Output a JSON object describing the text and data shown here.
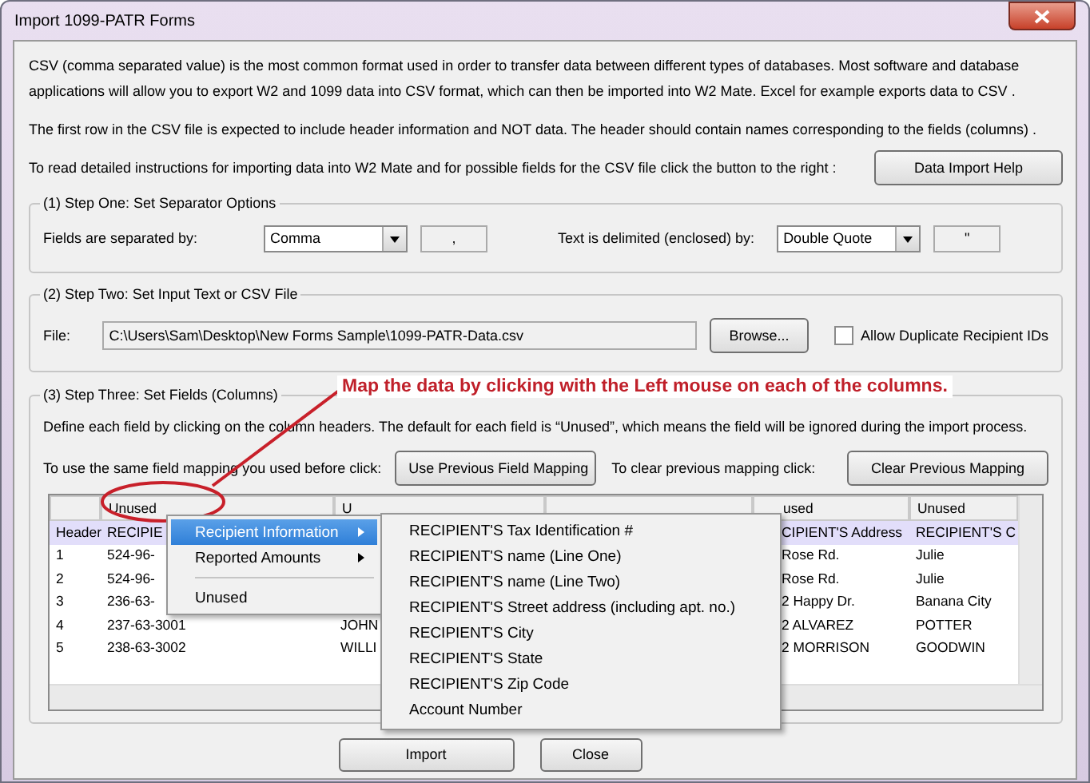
{
  "window": {
    "title": "Import 1099-PATR Forms"
  },
  "intro": {
    "paragraphs": [
      "CSV (comma separated value) is the most common format used in order to transfer data between different types of databases.  Most software and database applications will allow you to export W2 and 1099 data into CSV format, which can then be imported into W2 Mate. Excel for example exports data to CSV .",
      "The first row in the CSV file is expected to include header information and NOT data. The header should contain names corresponding to the fields (columns) ."
    ],
    "help_prompt": "To read detailed instructions for importing data into W2 Mate and for possible fields for the CSV file click the button to the right :",
    "help_button": "Data Import Help"
  },
  "step_one": {
    "title": "(1)  Step One: Set Separator Options",
    "field_separator_label": "Fields are separated by:",
    "field_separator": "Comma",
    "field_separator_char": ",",
    "text_delimiter_label": "Text is delimited (enclosed) by:",
    "text_delimiter": "Double Quote",
    "text_delimiter_char": "\""
  },
  "step_two": {
    "title": "(2)  Step Two: Set Input Text or CSV File",
    "file_label": "File:",
    "file_path": "C:\\Users\\Sam\\Desktop\\New Forms Sample\\1099-PATR-Data.csv",
    "browse_button": "Browse...",
    "allow_duplicates": {
      "label": "Allow Duplicate Recipient IDs",
      "checked": false
    }
  },
  "step_three": {
    "title": "(3)  Step Three: Set Fields (Columns)",
    "instructions": "Define each field by clicking on the column headers. The default for each field is “Unused”, which means the field will be ignored during the import process.",
    "previous_prompt": "To use the same field mapping you used before click:",
    "previous_button": "Use Previous Field Mapping",
    "clear_prompt": "To clear previous mapping click:",
    "clear_button": "Clear Previous Mapping",
    "table": {
      "columns": [
        {
          "label": "Unused"
        },
        {
          "label": "U"
        },
        {},
        {
          "label": "used"
        },
        {
          "label": "Unused"
        }
      ],
      "rows": [
        {
          "label": "Header",
          "header": true,
          "cells": [
            "RECIPIE",
            null,
            null,
            "CIPIENT'S Address",
            "RECIPIENT'S C"
          ]
        },
        {
          "label": "1",
          "header": false,
          "cells": [
            "524-96-",
            null,
            null,
            "Rose Rd.",
            "Julie"
          ]
        },
        {
          "label": "2",
          "header": false,
          "cells": [
            "524-96-",
            null,
            null,
            "Rose Rd.",
            "Julie"
          ]
        },
        {
          "label": "3",
          "header": false,
          "cells": [
            "236-63-",
            null,
            null,
            "2 Happy Dr.",
            "Banana City"
          ]
        },
        {
          "label": "4",
          "header": false,
          "cells": [
            "237-63-3001",
            "JOHN",
            null,
            "2 ALVAREZ",
            "POTTER"
          ]
        },
        {
          "label": "5",
          "header": false,
          "cells": [
            "238-63-3002",
            "WILLI",
            null,
            "2 MORRISON",
            "GOODWIN"
          ]
        }
      ]
    }
  },
  "context_menu": {
    "items": [
      {
        "label": "Recipient Information",
        "kind": "submenu",
        "selected": true
      },
      {
        "label": "Reported Amounts",
        "kind": "submenu",
        "selected": false
      },
      {
        "kind": "separator"
      },
      {
        "label": "Unused",
        "kind": "item",
        "selected": false
      }
    ]
  },
  "submenu": {
    "items": [
      "RECIPIENT'S Tax Identification #",
      "RECIPIENT'S name (Line One)",
      "RECIPIENT'S name (Line Two)",
      "RECIPIENT'S Street address (including apt. no.)",
      "RECIPIENT'S City",
      "RECIPIENT'S State",
      "RECIPIENT'S Zip Code",
      "Account Number"
    ]
  },
  "annotation": {
    "text": "Map the data by clicking with the Left mouse on each of the columns."
  },
  "buttons": [
    "Import",
    "Close"
  ]
}
